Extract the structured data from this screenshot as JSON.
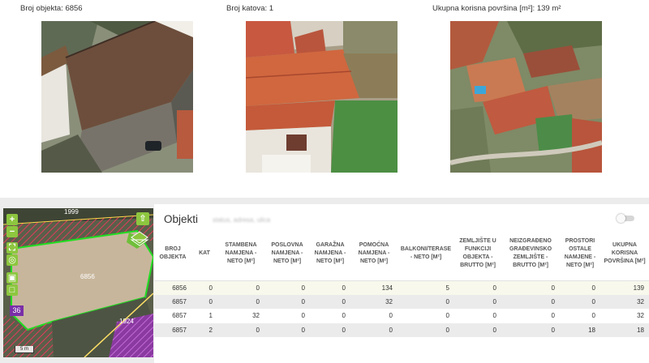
{
  "stats": {
    "broj_objekta": "Broj objekta: 6856",
    "broj_katova": "Broj katova: 1",
    "korisna_povrsina": "Ukupna korisna površina [m²]: 139 m²"
  },
  "photos": [
    "oblique-aerial-photo",
    "close-aerial-photo",
    "overview-aerial-photo"
  ],
  "map": {
    "label_top": "1999",
    "label_parcel": "6856",
    "label_right": "1924",
    "badge": "36",
    "scale": "5 m",
    "tools": [
      "zoom-in",
      "zoom-out",
      "fullscreen",
      "locate",
      "screenshot",
      "area-select"
    ],
    "colors": {
      "parcel_outline": "#22dd22",
      "hatch": "#e23b5a",
      "selected_fill": "#c8b69c"
    }
  },
  "panel": {
    "title": "Objekti",
    "subtitle": "status, adresa, ulica",
    "columns": [
      "BROJ OBJEKTA",
      "KAT",
      "STAMBENA NAMJENA - NETO [M²]",
      "POSLOVNA NAMJENA - NETO [M²]",
      "GARAŽNA NAMJENA - NETO [M²]",
      "POMOĆNA NAMJENA - NETO [M²]",
      "BALKONI/TERASE - NETO [M²]",
      "ZEMLJIŠTE U FUNKCIJI OBJEKTA - BRUTTO [M²]",
      "NEIZGRAĐENO GRAĐEVINSKO ZEMLJIŠTE - BRUTTO [M²]",
      "PROSTORI OSTALE NAMJENE - NETO [M²]",
      "UKUPNA KORISNA POVRŠINA [M²]"
    ],
    "rows": [
      [
        "6856",
        "0",
        "0",
        "0",
        "0",
        "134",
        "5",
        "0",
        "0",
        "0",
        "139"
      ],
      [
        "6857",
        "0",
        "0",
        "0",
        "0",
        "32",
        "0",
        "0",
        "0",
        "0",
        "32"
      ],
      [
        "6857",
        "1",
        "32",
        "0",
        "0",
        "0",
        "0",
        "0",
        "0",
        "0",
        "32"
      ],
      [
        "6857",
        "2",
        "0",
        "0",
        "0",
        "0",
        "0",
        "0",
        "0",
        "18",
        "18"
      ]
    ]
  }
}
